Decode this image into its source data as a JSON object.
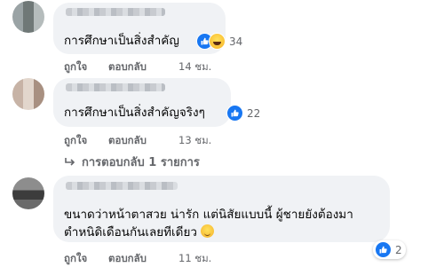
{
  "comments": [
    {
      "text": "การศึกษาเป็นสิ่งสำคัญ",
      "reaction_count": "34",
      "like_label": "ถูกใจ",
      "reply_label": "ตอบกลับ",
      "time": "14 ชม."
    },
    {
      "text": "การศึกษาเป็นสิ่งสำคัญจริงๆ",
      "reaction_count": "22",
      "like_label": "ถูกใจ",
      "reply_label": "ตอบกลับ",
      "time": "13 ชม.",
      "replies_link": "การตอบกลับ 1 รายการ"
    },
    {
      "text_line1": "ขนาดว่าหน้าตาสวย น่ารัก แต่นิสัยแบบนี้ ผู้ชายยังต้องมา",
      "text_line2": "ตำหนิดิเดือนกันเลยทีเดียว",
      "reaction_count": "2",
      "like_label": "ถูกใจ",
      "reply_label": "ตอบกลับ",
      "time": "11 ชม."
    }
  ],
  "colors": {
    "like_blue": "#1877f2",
    "bubble": "#f0f2f5",
    "meta_gray": "#65676b"
  },
  "icons": [
    "like-icon",
    "haha-icon",
    "reply-arrow-icon",
    "smile-emoji-icon"
  ]
}
